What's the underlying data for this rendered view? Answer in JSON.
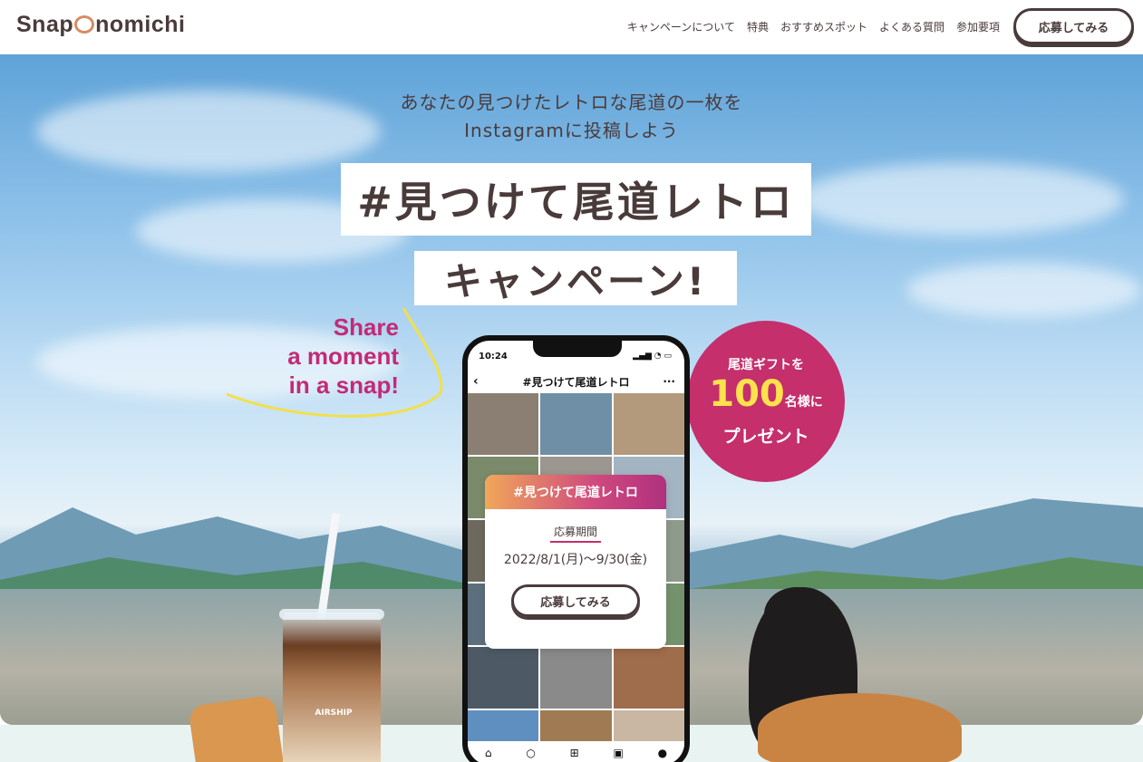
{
  "header": {
    "logo": "Snap",
    "logo_tail": "nomichi",
    "nav": [
      "キャンペーンについて",
      "特典",
      "おすすめスポット",
      "よくある質問",
      "参加要項"
    ],
    "cta": "応募してみる"
  },
  "hero": {
    "lead_line1": "あなたの見つけたレトロな尾道の一枚を",
    "lead_line2": "Instagramに投稿しよう",
    "title_line1": "#見つけて尾道レトロ",
    "title_line2": "キャンペーン!",
    "share_line1": "Share",
    "share_line2": "a moment",
    "share_line3": "in a snap!"
  },
  "badge": {
    "line1": "尾道ギフトを",
    "number": "100",
    "unit": "名様に",
    "line3": "プレゼント"
  },
  "phone": {
    "time": "10:24",
    "title": "#見つけて尾道レトロ",
    "back_icon": "‹",
    "more_icon": "···"
  },
  "card": {
    "header": "#見つけて尾道レトロ",
    "label": "応募期間",
    "period": "2022/8/1(月)〜9/30(金)",
    "button": "応募してみる"
  },
  "cup": {
    "brand": "AIRSHIP"
  },
  "colors": {
    "accent": "#c42f6c",
    "text": "#4a3b3b",
    "badge_number": "#ffe14d"
  }
}
